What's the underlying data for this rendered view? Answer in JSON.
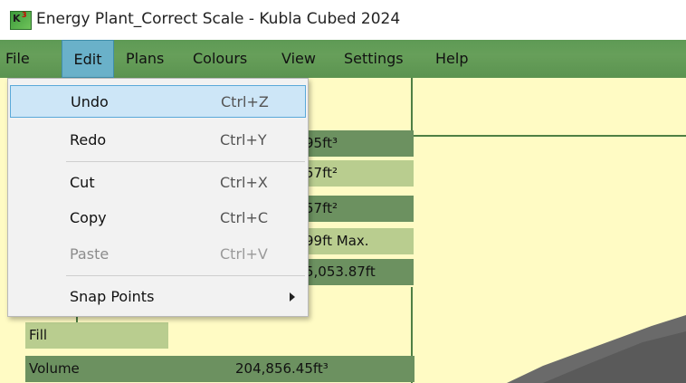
{
  "window": {
    "title": "Energy Plant_Correct Scale - Kubla Cubed 2024",
    "icon": "kubla-k3-icon"
  },
  "menubar": {
    "items": [
      {
        "label": "File"
      },
      {
        "label": "Edit"
      },
      {
        "label": "Plans"
      },
      {
        "label": "Colours"
      },
      {
        "label": "View"
      },
      {
        "label": "Settings"
      },
      {
        "label": "Help"
      }
    ],
    "active": "Edit"
  },
  "edit_menu": {
    "items": [
      {
        "label": "Undo",
        "shortcut": "Ctrl+Z",
        "highlighted": true
      },
      {
        "label": "Redo",
        "shortcut": "Ctrl+Y"
      },
      {
        "label": "Cut",
        "shortcut": "Ctrl+X"
      },
      {
        "label": "Copy",
        "shortcut": "Ctrl+C"
      },
      {
        "label": "Paste",
        "shortcut": "Ctrl+V",
        "disabled": true
      },
      {
        "label": "Snap Points",
        "submenu": true,
        "icon": "chevron-right-icon"
      }
    ]
  },
  "panel": {
    "partial_values": [
      "95ft³",
      "57ft²",
      "57ft²",
      "99ft Max.",
      "5,053.87ft"
    ],
    "fill_label": "Fill",
    "volume_label": "Volume",
    "volume_value": "204,856.45ft³"
  },
  "colors": {
    "menubar": "#679f5a",
    "canvas": "#fffbc4",
    "dark_row": "#6c9160",
    "light_row": "#b9cd8f",
    "menu_highlight": "#cde6f7"
  }
}
